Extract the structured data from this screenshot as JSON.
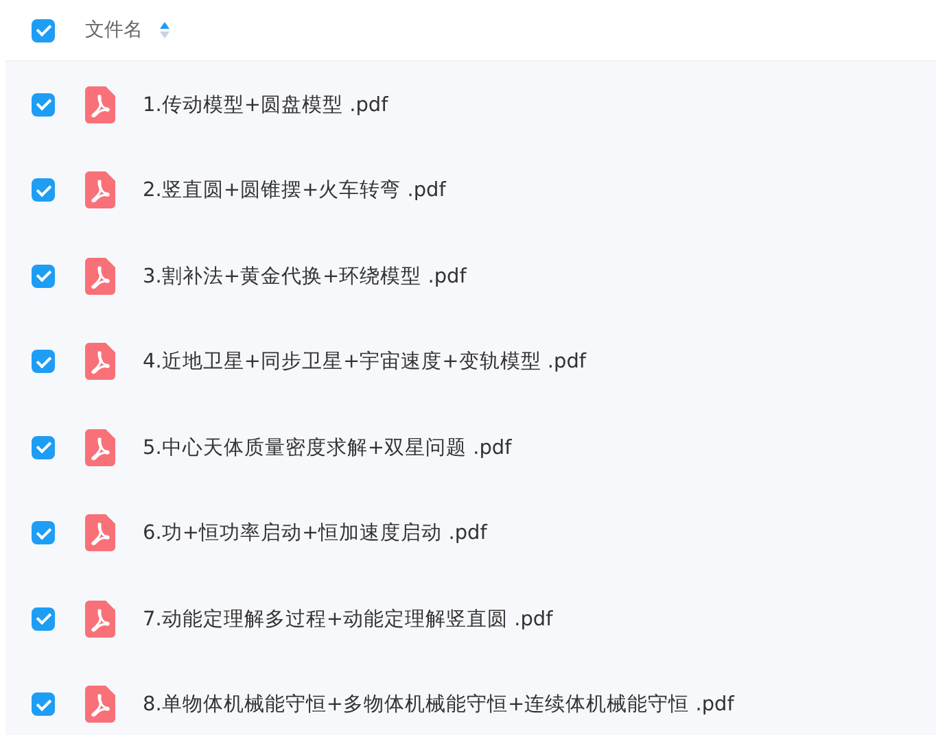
{
  "header": {
    "checked": true,
    "column_label": "文件名"
  },
  "files": [
    {
      "name": "1.传动模型+圆盘模型 .pdf",
      "checked": true
    },
    {
      "name": "2.竖直圆+圆锥摆+火车转弯 .pdf",
      "checked": true
    },
    {
      "name": "3.割补法+黄金代换+环绕模型 .pdf",
      "checked": true
    },
    {
      "name": "4.近地卫星+同步卫星+宇宙速度+变轨模型 .pdf",
      "checked": true
    },
    {
      "name": "5.中心天体质量密度求解+双星问题 .pdf",
      "checked": true
    },
    {
      "name": "6.功+恒功率启动+恒加速度启动 .pdf",
      "checked": true
    },
    {
      "name": "7.动能定理解多过程+动能定理解竖直圆 .pdf",
      "checked": true
    },
    {
      "name": "8.单物体机械能守恒+多物体机械能守恒+连续体机械能守恒 .pdf",
      "checked": true
    }
  ]
}
